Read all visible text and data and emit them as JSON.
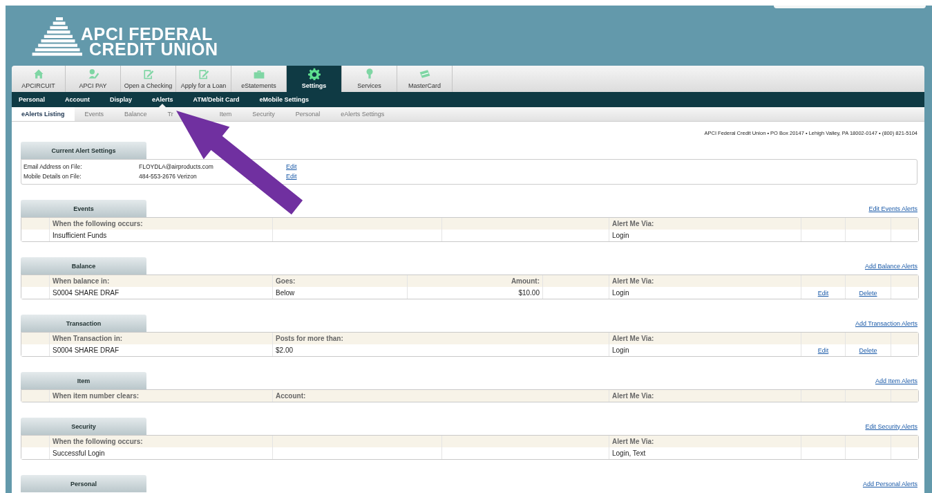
{
  "brand": {
    "line_1": "APCI FEDERAL",
    "line_2": "CREDIT UNION"
  },
  "main_tabs": [
    {
      "label": "APCIRCUIT",
      "selected": false
    },
    {
      "label": "APCI PAY",
      "selected": false
    },
    {
      "label": "Open a Checking",
      "selected": false
    },
    {
      "label": "Apply for a Loan",
      "selected": false
    },
    {
      "label": "eStatements",
      "selected": false
    },
    {
      "label": "Settings",
      "selected": true
    },
    {
      "label": "Services",
      "selected": false
    },
    {
      "label": "MasterCard",
      "selected": false
    }
  ],
  "sub_nav": [
    {
      "label": "Personal",
      "selected": false
    },
    {
      "label": "Account",
      "selected": false
    },
    {
      "label": "Display",
      "selected": false
    },
    {
      "label": "eAlerts",
      "selected": true
    },
    {
      "label": "ATM/Debit Card",
      "selected": false
    },
    {
      "label": "eMobile Settings",
      "selected": false
    }
  ],
  "alert_tabs": [
    {
      "label": "eAlerts Listing",
      "selected": true
    },
    {
      "label": "Events",
      "selected": false
    },
    {
      "label": "Balance",
      "selected": false
    },
    {
      "label": "Tr",
      "selected": false
    },
    {
      "label": "Item",
      "selected": false
    },
    {
      "label": "Security",
      "selected": false
    },
    {
      "label": "Personal",
      "selected": false
    },
    {
      "label": "eAlerts Settings",
      "selected": false
    }
  ],
  "address_line": "APCI Federal Credit Union • PO Box 20147 • Lehigh Valley, PA 18002-0147 • (800) 821-5104",
  "current_settings": {
    "title": "Current Alert Settings",
    "rows": [
      {
        "label": "Email Address on File:",
        "value": "FLOYDLA@airproducts.com",
        "link": "Edit"
      },
      {
        "label": "Mobile Details on File:",
        "value": "484-553-2676 Verizon",
        "link": "Edit"
      }
    ]
  },
  "sections": [
    {
      "kind": "events",
      "title": "Events",
      "action": "Edit Events Alerts",
      "columns": [
        "When the following occurs:",
        "Alert Me Via:"
      ],
      "rows": [
        {
          "cells": [
            "Insufficient Funds",
            "Login"
          ]
        }
      ]
    },
    {
      "kind": "balance",
      "title": "Balance",
      "action": "Add Balance Alerts",
      "columns": [
        "When balance in:",
        "Goes:",
        "Amount:",
        "Alert Me Via:"
      ],
      "rows": [
        {
          "cells": [
            "S0004 SHARE DRAF",
            "Below",
            "$10.00",
            "Login"
          ],
          "links": [
            "Edit",
            "Delete"
          ]
        }
      ]
    },
    {
      "kind": "transaction",
      "title": "Transaction",
      "action": "Add Transaction Alerts",
      "columns": [
        "When Transaction in:",
        "Posts for more than:",
        "Alert Me Via:"
      ],
      "rows": [
        {
          "cells": [
            "S0004 SHARE DRAF",
            "$2.00",
            "Login"
          ],
          "links": [
            "Edit",
            "Delete"
          ]
        }
      ]
    },
    {
      "kind": "item",
      "title": "Item",
      "action": "Add Item Alerts",
      "columns": [
        "When item number clears:",
        "Account:",
        "Alert Me Via:"
      ]
    },
    {
      "kind": "events",
      "title": "Security",
      "action": "Edit Security Alerts",
      "columns": [
        "When the following occurs:",
        "Alert Me Via:"
      ],
      "rows": [
        {
          "cells": [
            "Successful Login",
            "Login, Text"
          ]
        }
      ]
    },
    {
      "kind": "cutoff",
      "title": "Personal",
      "action": "Add Personal Alerts"
    }
  ]
}
